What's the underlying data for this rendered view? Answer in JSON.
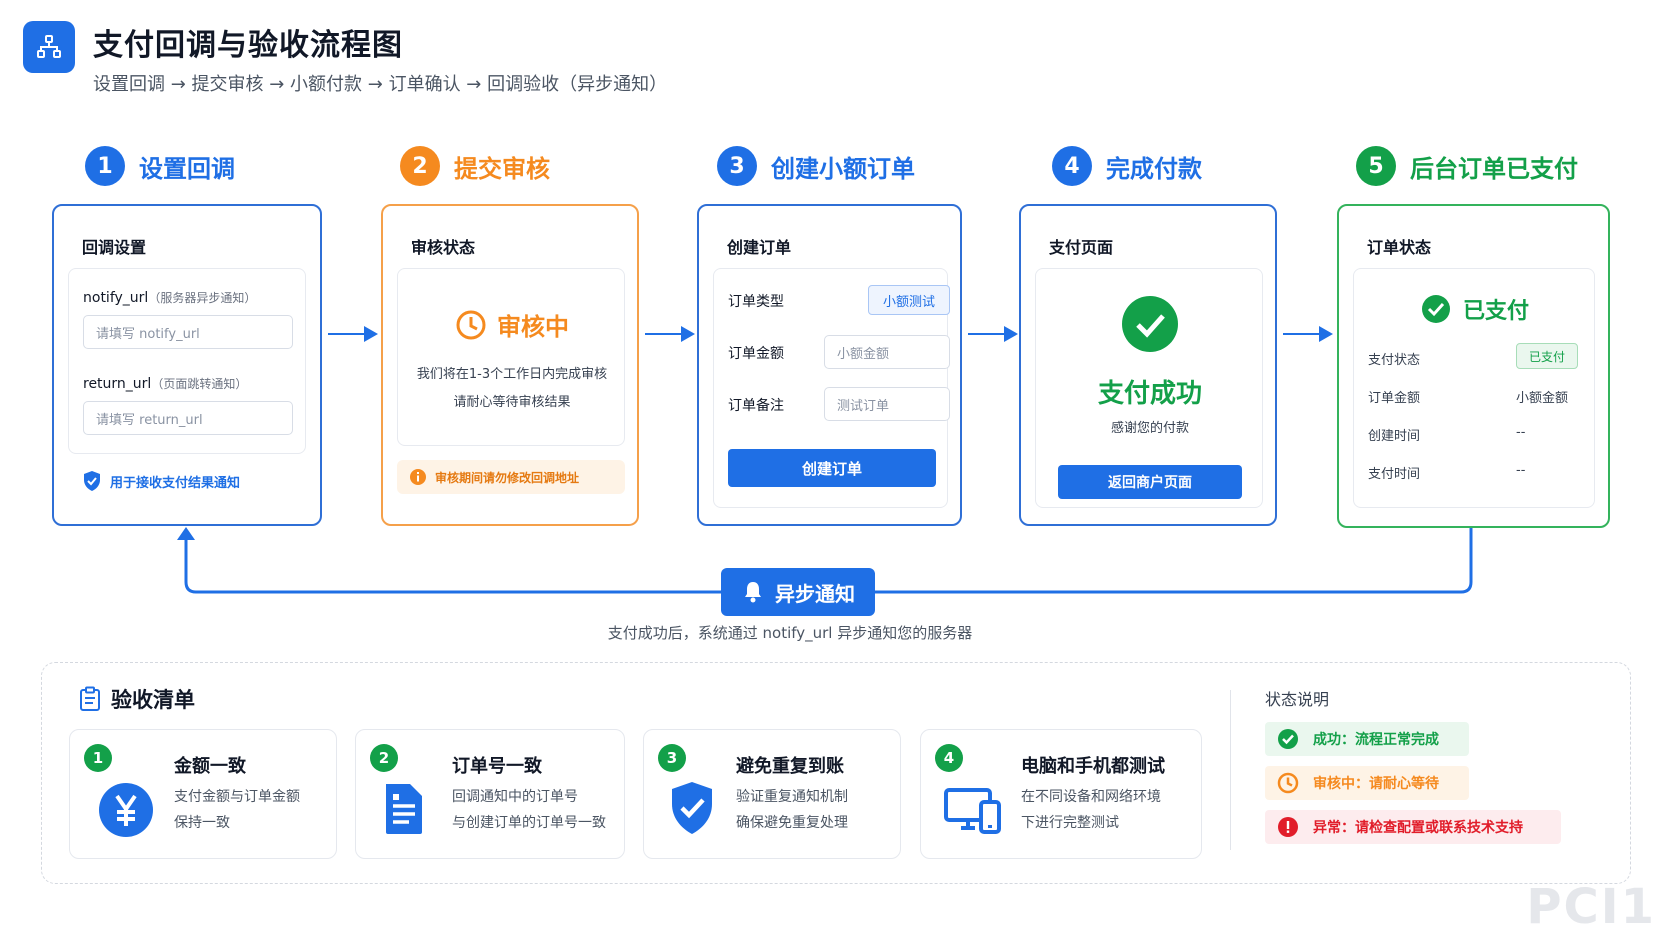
{
  "header": {
    "title": "支付回调与验收流程图",
    "subtitle": "设置回调 → 提交审核 → 小额付款 → 订单确认 → 回调验收（异步通知）"
  },
  "steps": [
    {
      "num": "1",
      "title": "设置回调",
      "color": "#1f6fe5"
    },
    {
      "num": "2",
      "title": "提交审核",
      "color": "#f58a1f"
    },
    {
      "num": "3",
      "title": "创建小额订单",
      "color": "#1f6fe5"
    },
    {
      "num": "4",
      "title": "完成付款",
      "color": "#1f6fe5"
    },
    {
      "num": "5",
      "title": "后台订单已支付",
      "color": "#13a049"
    }
  ],
  "card1": {
    "label": "回调设置",
    "notify_label": "notify_url",
    "notify_hint": "（服务器异步通知）",
    "notify_placeholder": "请填写 notify_url",
    "return_label": "return_url",
    "return_hint": "（页面跳转通知）",
    "return_placeholder": "请填写 return_url",
    "note": "用于接收支付结果通知"
  },
  "card2": {
    "label": "审核状态",
    "status": "审核中",
    "desc_line1": "我们将在1-3个工作日内完成审核",
    "desc_line2": "请耐心等待审核结果",
    "warning": "审核期间请勿修改回调地址"
  },
  "card3": {
    "label": "创建订单",
    "type_label": "订单类型",
    "type_value": "小额测试",
    "amount_label": "订单金额",
    "amount_placeholder": "小额金额",
    "remark_label": "订单备注",
    "remark_placeholder": "测试订单",
    "button": "创建订单"
  },
  "card4": {
    "label": "支付页面",
    "status": "支付成功",
    "thanks": "感谢您的付款",
    "button": "返回商户页面"
  },
  "card5": {
    "label": "订单状态",
    "status": "已支付",
    "rows": [
      {
        "key": "支付状态",
        "value": "已支付"
      },
      {
        "key": "订单金额",
        "value": "小额金额"
      },
      {
        "key": "创建时间",
        "value": "--"
      },
      {
        "key": "支付时间",
        "value": "--"
      }
    ]
  },
  "async": {
    "badge": "异步通知",
    "caption": "支付成功后，系统通过 notify_url 异步通知您的服务器"
  },
  "checklist": {
    "title": "验收清单",
    "items": [
      {
        "num": "1",
        "title": "金额一致",
        "line1": "支付金额与订单金额",
        "line2": "保持一致"
      },
      {
        "num": "2",
        "title": "订单号一致",
        "line1": "回调通知中的订单号",
        "line2": "与创建订单的订单号一致"
      },
      {
        "num": "3",
        "title": "避免重复到账",
        "line1": "验证重复通知机制",
        "line2": "确保避免重复处理"
      },
      {
        "num": "4",
        "title": "电脑和手机都测试",
        "line1": "在不同设备和网络环境",
        "line2": "下进行完整测试"
      }
    ]
  },
  "legend": {
    "title": "状态说明",
    "items": [
      {
        "text": "成功：流程正常完成",
        "color": "#13a049",
        "bg": "#eaf7ee"
      },
      {
        "text": "审核中：请耐心等待",
        "color": "#f58a1f",
        "bg": "#fef3e6"
      },
      {
        "text": "异常：请检查配置或联系技术支持",
        "color": "#e11d2a",
        "bg": "#fdecee"
      }
    ]
  },
  "watermark": "PCI1"
}
